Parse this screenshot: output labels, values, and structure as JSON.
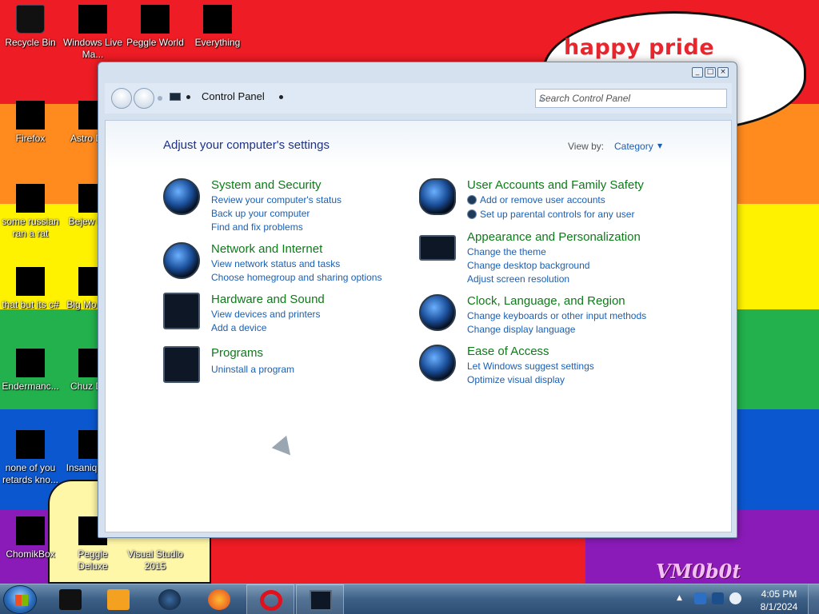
{
  "wallpaper": {
    "bubble_text": "happy pride month",
    "watermark": "VM0b0t",
    "stripe_colors": [
      "#ee1c24",
      "#ff8a1e",
      "#fff200",
      "#22b14c",
      "#0b57d0",
      "#8a1bb8"
    ]
  },
  "desktop_icons": [
    {
      "label": "Recycle Bin",
      "icon": "recycle-bin-icon"
    },
    {
      "label": "Windows Live Ma...",
      "icon": "windows-live-mail-icon"
    },
    {
      "label": "Peggle World",
      "icon": "peggle-world-icon"
    },
    {
      "label": "Everything",
      "icon": "everything-search-icon"
    },
    {
      "label": "Firefox",
      "icon": "firefox-icon"
    },
    {
      "label": "Astro Delu",
      "icon": "app-icon"
    },
    {
      "label": "some russian ran a rat",
      "icon": "app-icon"
    },
    {
      "label": "Bejew Delu",
      "icon": "app-icon"
    },
    {
      "label": "that but its c#",
      "icon": "app-icon"
    },
    {
      "label": "Big Mo Delu",
      "icon": "app-icon"
    },
    {
      "label": "Endermanc...",
      "icon": "app-icon"
    },
    {
      "label": "Chuz Delu",
      "icon": "app-icon"
    },
    {
      "label": "none of you retards kno...",
      "icon": "app-icon"
    },
    {
      "label": "Insaniq Delu",
      "icon": "app-icon"
    },
    {
      "label": "ChomikBox",
      "icon": "chomikbox-icon"
    },
    {
      "label": "Peggle Deluxe",
      "icon": "peggle-deluxe-icon"
    },
    {
      "label": "Visual Studio 2015",
      "icon": "visual-studio-icon"
    }
  ],
  "window": {
    "address": "Control Panel",
    "search_placeholder": "Search Control Panel",
    "heading": "Adjust your computer's settings",
    "view_by_label": "View by:",
    "view_by_value": "Category",
    "categories_left": [
      {
        "title": "System and Security",
        "icon": "system-security-icon",
        "links": [
          "Review your computer's status",
          "Back up your computer",
          "Find and fix problems"
        ]
      },
      {
        "title": "Network and Internet",
        "icon": "network-internet-icon",
        "links": [
          "View network status and tasks",
          "Choose homegroup and sharing options"
        ]
      },
      {
        "title": "Hardware and Sound",
        "icon": "hardware-sound-icon",
        "links": [
          "View devices and printers",
          "Add a device"
        ]
      },
      {
        "title": "Programs",
        "icon": "programs-icon",
        "links": [
          "Uninstall a program"
        ]
      }
    ],
    "categories_right": [
      {
        "title": "User Accounts and Family Safety",
        "icon": "user-accounts-icon",
        "links": [
          "Add or remove user accounts",
          "Set up parental controls for any user"
        ]
      },
      {
        "title": "Appearance and Personalization",
        "icon": "appearance-icon",
        "links": [
          "Change the theme",
          "Change desktop background",
          "Adjust screen resolution"
        ]
      },
      {
        "title": "Clock, Language, and Region",
        "icon": "clock-language-icon",
        "links": [
          "Change keyboards or other input methods",
          "Change display language"
        ]
      },
      {
        "title": "Ease of Access",
        "icon": "ease-of-access-icon",
        "links": [
          "Let Windows suggest settings",
          "Optimize visual display"
        ]
      }
    ]
  },
  "taskbar": {
    "items": [
      "explorer-icon",
      "media-player-icon",
      "globe-icon",
      "firefox-icon",
      "opera-icon",
      "control-panel-icon"
    ],
    "clock_time": "4:05 PM",
    "clock_date": "8/1/2024"
  }
}
